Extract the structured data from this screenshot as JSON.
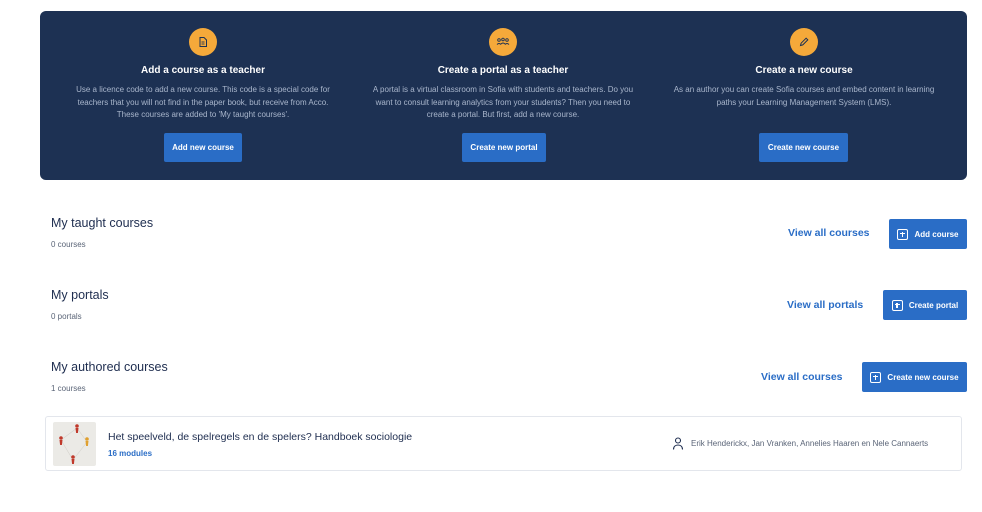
{
  "hero": {
    "columns": [
      {
        "icon": "document-icon",
        "title": "Add a course as a teacher",
        "description": "Use a licence code to add a new course. This code is a special code for teachers that you will not find in the paper book, but receive from Acco. These courses are added to 'My taught courses'.",
        "button": "Add new course"
      },
      {
        "icon": "group-icon",
        "title": "Create a portal as a teacher",
        "description": "A portal is a virtual classroom in Sofia with students and teachers. Do you want to consult learning analytics from your students? Then you need to create a portal. But first, add a new course.",
        "button": "Create new portal"
      },
      {
        "icon": "pencil-icon",
        "title": "Create a new course",
        "description": "As an author you can create Sofia courses and embed content in learning paths your Learning Management System (LMS).",
        "button": "Create new course"
      }
    ],
    "colors": {
      "background": "#1d3153",
      "icon_bg": "#f5a93a",
      "button": "#2a6dc6"
    }
  },
  "sections": {
    "taught": {
      "title": "My taught courses",
      "count": "0 courses",
      "view_link": "View all courses",
      "action": "Add course"
    },
    "portals": {
      "title": "My portals",
      "count": "0 portals",
      "view_link": "View all portals",
      "action": "Create portal"
    },
    "authored": {
      "title": "My authored courses",
      "count": "1 courses",
      "view_link": "View all courses",
      "action": "Create new course"
    }
  },
  "authored_courses": [
    {
      "title": "Het speelveld, de spelregels en de spelers? Handboek sociologie",
      "modules": "16 modules",
      "authors": "Erik Henderickx, Jan Vranken, Annelies Haaren en Nele Cannaerts"
    }
  ]
}
